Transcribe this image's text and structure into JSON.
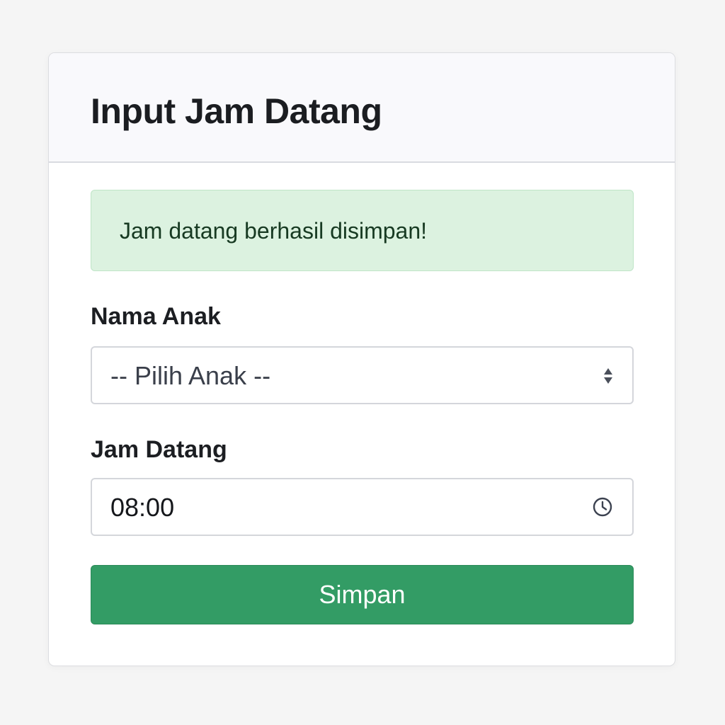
{
  "form": {
    "title": "Input Jam Datang",
    "alert_message": "Jam datang berhasil disimpan!",
    "child_name": {
      "label": "Nama Anak",
      "selected_value": "-- Pilih Anak --",
      "icon": "select-arrows-icon"
    },
    "arrival_time": {
      "label": "Jam Datang",
      "value": "08:00",
      "icon": "clock-icon"
    },
    "submit_label": "Simpan"
  },
  "colors": {
    "background": "#f5f5f5",
    "alert_background": "#dcf2e0",
    "alert_text": "#173a22",
    "button": "#339c65",
    "button_text": "#ffffff"
  }
}
